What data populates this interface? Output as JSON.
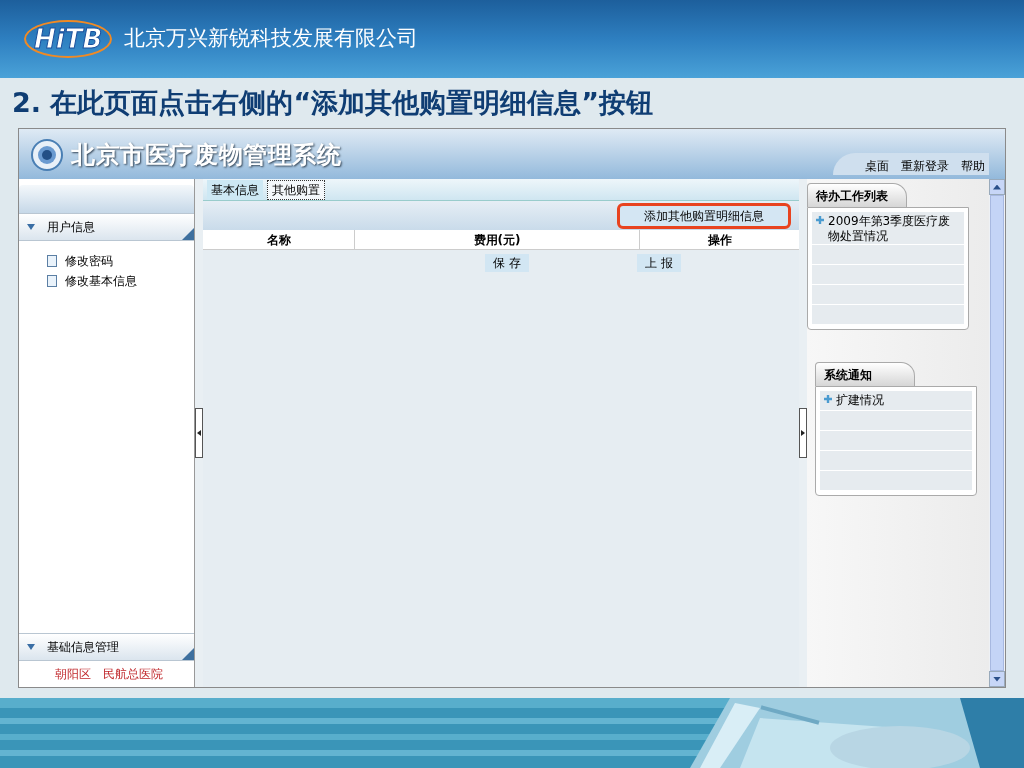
{
  "slide": {
    "logo": "HiTB",
    "company": "北京万兴新锐科技发展有限公司",
    "heading": "2. 在此页面点击右侧的“添加其他购置明细信息”按钮"
  },
  "app": {
    "title": "北京市医疗废物管理系统",
    "nav": [
      "桌面",
      "重新登录",
      "帮助"
    ],
    "sidebar": {
      "sections": [
        {
          "label": "用户信息",
          "items": [
            "修改密码",
            "修改基本信息"
          ]
        },
        {
          "label": "基础信息管理"
        }
      ],
      "footer": [
        "朝阳区",
        "民航总医院"
      ]
    },
    "tabs": [
      {
        "label": "基本信息",
        "selected": false
      },
      {
        "label": "其他购置",
        "selected": true
      }
    ],
    "add_button": {
      "label": "添加其他购置明细信息",
      "highlighted": true
    },
    "table": {
      "columns": [
        "名称",
        "费用(元)",
        "操作"
      ]
    },
    "actions": [
      "保 存",
      "上 报"
    ],
    "todo": {
      "title": "待办工作列表",
      "items": [
        "2009年第3季度医疗废物处置情况"
      ]
    },
    "notices": {
      "title": "系统通知",
      "items": [
        "扩建情况"
      ]
    }
  }
}
